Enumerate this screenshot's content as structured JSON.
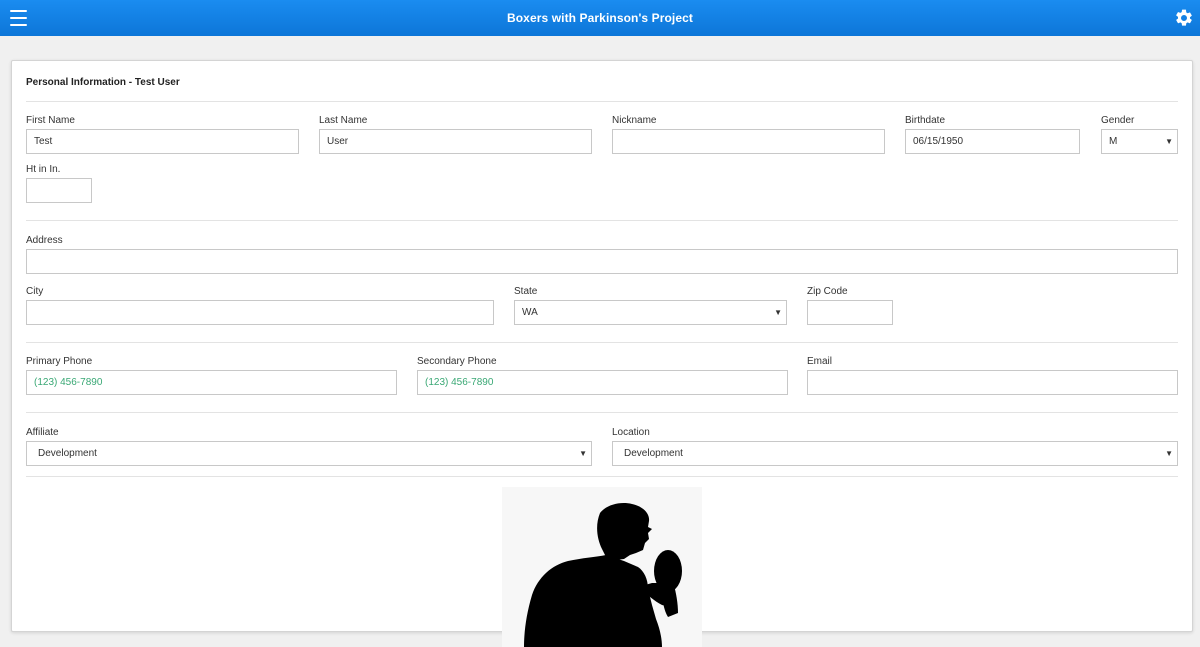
{
  "header": {
    "title": "Boxers with Parkinson's Project",
    "menu_icon": "hamburger-icon",
    "settings_icon": "gear-icon",
    "color": "#1586e8"
  },
  "card": {
    "title": "Personal Information - Test User"
  },
  "fields": {
    "first_name": {
      "label": "First Name",
      "value": "Test"
    },
    "last_name": {
      "label": "Last Name",
      "value": "User"
    },
    "nickname": {
      "label": "Nickname",
      "value": ""
    },
    "birthdate": {
      "label": "Birthdate",
      "value": "06/15/1950"
    },
    "gender": {
      "label": "Gender",
      "value": "M"
    },
    "height": {
      "label": "Ht in In.",
      "value": ""
    },
    "address": {
      "label": "Address",
      "value": ""
    },
    "city": {
      "label": "City",
      "value": ""
    },
    "state": {
      "label": "State",
      "value": "WA"
    },
    "zip": {
      "label": "Zip Code",
      "value": ""
    },
    "primary_phone": {
      "label": "Primary Phone",
      "placeholder": "(123) 456-7890"
    },
    "secondary_phone": {
      "label": "Secondary Phone",
      "placeholder": "(123) 456-7890"
    },
    "email": {
      "label": "Email",
      "value": ""
    },
    "affiliate": {
      "label": "Affiliate",
      "value": "Development"
    },
    "location": {
      "label": "Location",
      "value": "Development"
    }
  },
  "image": {
    "icon": "boxer-silhouette-icon"
  }
}
